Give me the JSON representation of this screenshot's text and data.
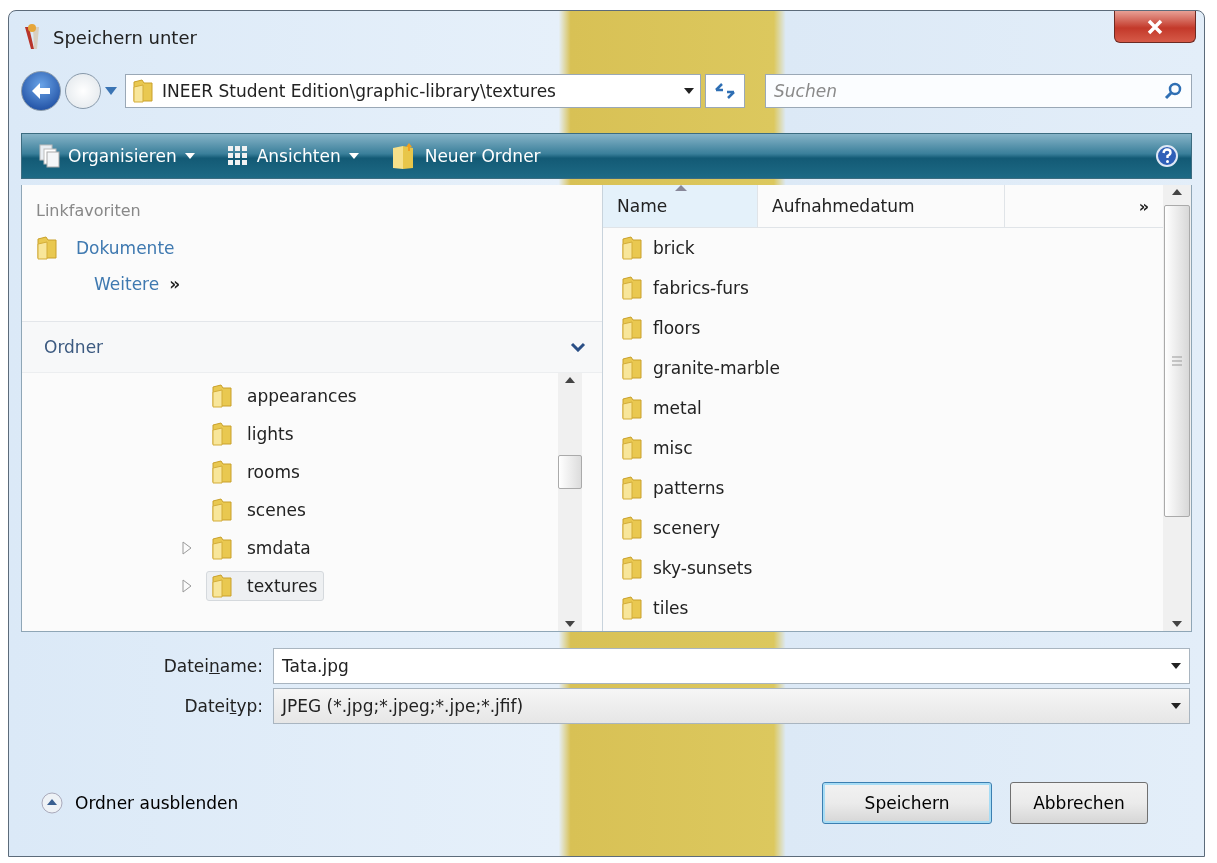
{
  "window": {
    "title": "Speichern unter"
  },
  "address": {
    "path": "INEER Student Edition\\graphic-library\\textures"
  },
  "search": {
    "placeholder": "Suchen"
  },
  "toolbar": [
    {
      "label": "Organisieren",
      "kind": "organize"
    },
    {
      "label": "Ansichten",
      "kind": "views"
    },
    {
      "label": "Neuer Ordner",
      "kind": "newfolder"
    }
  ],
  "favorites": {
    "heading": "Linkfavoriten",
    "items": [
      {
        "label": "Dokumente"
      }
    ],
    "more": "Weitere",
    "more_glyph": "»"
  },
  "folders": {
    "heading": "Ordner",
    "expanded": true,
    "tree": [
      {
        "label": "appearances",
        "expandable": false,
        "selected": false
      },
      {
        "label": "lights",
        "expandable": false,
        "selected": false
      },
      {
        "label": "rooms",
        "expandable": false,
        "selected": false
      },
      {
        "label": "scenes",
        "expandable": false,
        "selected": false
      },
      {
        "label": "smdata",
        "expandable": true,
        "selected": false
      },
      {
        "label": "textures",
        "expandable": true,
        "selected": true
      }
    ]
  },
  "file_list": {
    "columns": [
      {
        "label": "Name",
        "sorted": true
      },
      {
        "label": "Aufnahmedatum",
        "sorted": false
      }
    ],
    "overflow": "»",
    "rows": [
      "brick",
      "fabrics-furs",
      "floors",
      "granite-marble",
      "metal",
      "misc",
      "patterns",
      "scenery",
      "sky-sunsets",
      "tiles"
    ]
  },
  "filename": {
    "label_before": "Datei",
    "access_key": "n",
    "label_after": "ame:",
    "value": "Tata.jpg"
  },
  "filetype": {
    "label_before": "Datei",
    "access_key": "t",
    "label_after": "yp:",
    "value": "JPEG (*.jpg;*.jpeg;*.jpe;*.jfif)"
  },
  "hide_folders": {
    "label": "Ordner ausblenden"
  },
  "buttons": [
    {
      "label": "Speichern",
      "default": true
    },
    {
      "label": "Abbrechen",
      "default": false
    }
  ]
}
